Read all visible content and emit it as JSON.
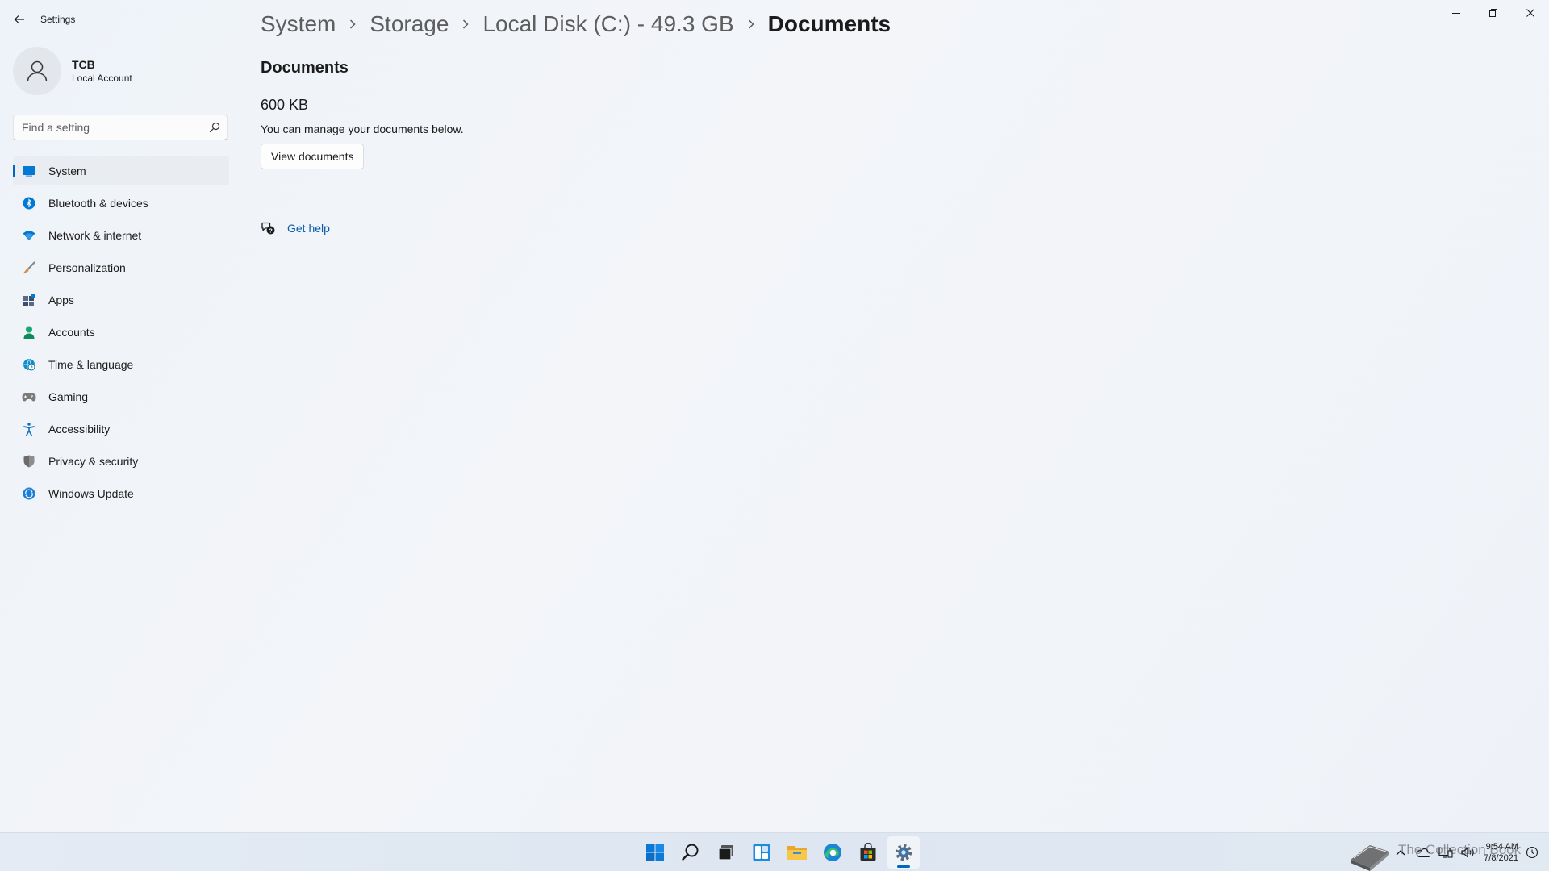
{
  "window": {
    "app_title": "Settings",
    "controls": [
      "minimize",
      "restore",
      "close"
    ]
  },
  "profile": {
    "name": "TCB",
    "account_type": "Local Account"
  },
  "search": {
    "placeholder": "Find a setting"
  },
  "sidebar": {
    "items": [
      {
        "label": "System",
        "icon": "system-icon",
        "selected": true,
        "color": "#0078d4"
      },
      {
        "label": "Bluetooth & devices",
        "icon": "bluetooth-icon",
        "color": "#0078d4"
      },
      {
        "label": "Network & internet",
        "icon": "wifi-icon",
        "color": "#0078d4"
      },
      {
        "label": "Personalization",
        "icon": "brush-icon",
        "color": "#e3883b"
      },
      {
        "label": "Apps",
        "icon": "apps-icon",
        "color": "#5a6a84"
      },
      {
        "label": "Accounts",
        "icon": "accounts-icon",
        "color": "#18a872"
      },
      {
        "label": "Time & language",
        "icon": "globe-clock-icon",
        "color": "#0a8fcb"
      },
      {
        "label": "Gaming",
        "icon": "gamepad-icon",
        "color": "#7b7b7b"
      },
      {
        "label": "Accessibility",
        "icon": "accessibility-icon",
        "color": "#1674c5"
      },
      {
        "label": "Privacy & security",
        "icon": "shield-icon",
        "color": "#6b6b6b"
      },
      {
        "label": "Windows Update",
        "icon": "update-icon",
        "color": "#1a7fd6"
      }
    ]
  },
  "breadcrumb": {
    "items": [
      "System",
      "Storage",
      "Local Disk (C:) - 49.3 GB",
      "Documents"
    ]
  },
  "main": {
    "section_title": "Documents",
    "size": "600 KB",
    "description": "You can manage your documents below.",
    "view_button": "View documents",
    "help_link": "Get help"
  },
  "taskbar": {
    "apps": [
      "start-icon",
      "search-icon",
      "task-view-icon",
      "widgets-icon",
      "file-explorer-icon",
      "edge-icon",
      "store-icon",
      "settings-icon"
    ],
    "active_app": "settings-icon",
    "tray": {
      "time": "9:54 AM",
      "date": "7/8/2021",
      "watermark": "The Collection Book"
    }
  },
  "colors": {
    "accent": "#0067c0",
    "link": "#0b5cad",
    "background": "#f1f4f9"
  }
}
